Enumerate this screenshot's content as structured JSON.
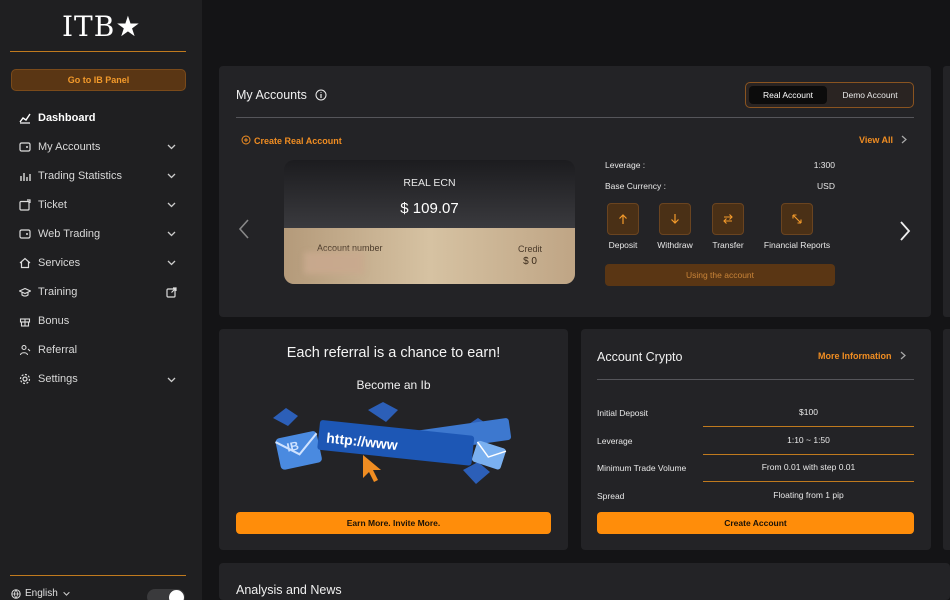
{
  "sidebar": {
    "logo": "ITB★",
    "ib_button": "Go to IB Panel",
    "items": [
      {
        "label": "Dashboard",
        "icon": "dashboard-icon",
        "active": true,
        "chevron": false
      },
      {
        "label": "My Accounts",
        "icon": "wallet-icon",
        "chevron": true
      },
      {
        "label": "Trading Statistics",
        "icon": "bar-chart-icon",
        "chevron": true
      },
      {
        "label": "Ticket",
        "icon": "ticket-icon",
        "chevron": true
      },
      {
        "label": "Web Trading",
        "icon": "web-trading-icon",
        "chevron": true
      },
      {
        "label": "Services",
        "icon": "home-icon",
        "chevron": true
      },
      {
        "label": "Training",
        "icon": "graduation-cap-icon",
        "external": true
      },
      {
        "label": "Bonus",
        "icon": "gift-icon"
      },
      {
        "label": "Referral",
        "icon": "referral-icon"
      },
      {
        "label": "Settings",
        "icon": "gear-icon",
        "chevron": true
      }
    ],
    "language": "English"
  },
  "accounts": {
    "title": "My Accounts",
    "tabs": {
      "real": "Real Account",
      "demo": "Demo Account"
    },
    "create_link": "Create Real Account",
    "view_all": "View All",
    "card": {
      "type": "REAL ECN",
      "balance": "$ 109.07",
      "account_number_label": "Account number",
      "credit_label": "Credit",
      "credit_value": "$ 0"
    },
    "info": [
      {
        "label": "Leverage :",
        "value": "1:300"
      },
      {
        "label": "Base Currency :",
        "value": "USD"
      }
    ],
    "actions": [
      {
        "label": "Deposit",
        "icon": "arrow-up-icon"
      },
      {
        "label": "Withdraw",
        "icon": "arrow-down-icon"
      },
      {
        "label": "Transfer",
        "icon": "transfer-icon"
      },
      {
        "label": "Financial Reports",
        "icon": "expand-arrows-icon"
      }
    ],
    "using_button": "Using the account"
  },
  "referral": {
    "title": "Each referral is a chance to earn!",
    "subtitle": "Become an Ib",
    "button": "Earn More. Invite More.",
    "illustration_text": "http://www"
  },
  "crypto": {
    "title": "Account Crypto",
    "more_link": "More Information",
    "rows": [
      {
        "label": "Initial Deposit",
        "value": "$100"
      },
      {
        "label": "Leverage",
        "value": "1:10 ~ 1:50"
      },
      {
        "label": "Minimum Trade Volume",
        "value": "From 0.01 with step 0.01"
      },
      {
        "label": "Spread",
        "value": "Floating from 1 pip"
      }
    ],
    "button": "Create Account"
  },
  "news": {
    "title": "Analysis and News"
  },
  "colors": {
    "accent": "#ff8d0a",
    "accent_dark": "#5a3614",
    "bg": "#141416",
    "card": "#232326"
  }
}
